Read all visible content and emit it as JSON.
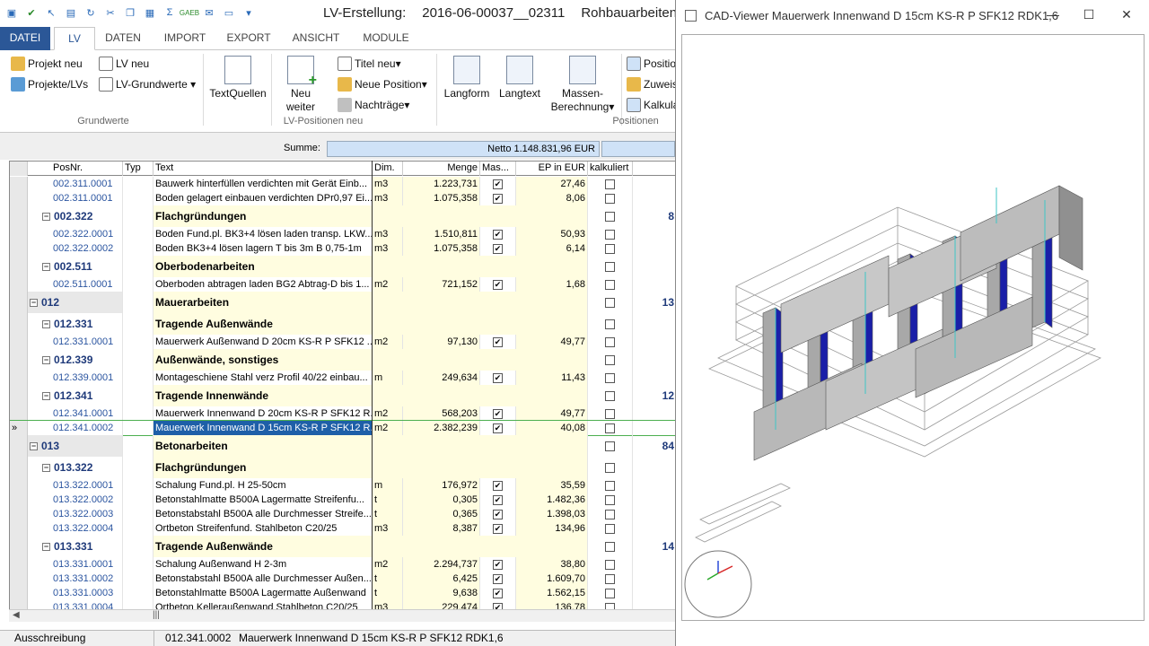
{
  "window": {
    "title_prefix": "LV-Erstellung:",
    "project_number": "2016-06-00037__02311",
    "project_name": "Rohbauarbeiten"
  },
  "tabs": [
    "DATEI",
    "LV",
    "DATEN",
    "IMPORT",
    "EXPORT",
    "ANSICHT",
    "MODULE"
  ],
  "ribbon": {
    "projekt_neu": "Projekt neu",
    "projekte_lvs": "Projekte/LVs",
    "lv_neu": "LV neu",
    "lv_grundwerte": "LV-Grundwerte",
    "textquellen": "TextQuellen",
    "neu_weiter_1": "Neu",
    "neu_weiter_2": "weiter",
    "titel_neu": "Titel neu",
    "neue_position": "Neue Position",
    "nachtraege": "Nachträge",
    "langform": "Langform",
    "langtext": "Langtext",
    "massen_1": "Massen-",
    "massen_2": "Berechnung",
    "position": "Positio",
    "zuweis": "Zuweis",
    "kalkula": "Kalkula",
    "group_grundwerte": "Grundwerte",
    "group_lv_positionen": "LV-Positionen neu",
    "group_positionen": "Positionen"
  },
  "summary": {
    "label": "Summe:",
    "netto": "Netto     1.148.831,96 EUR"
  },
  "columns": [
    "PosNr.",
    "Typ",
    "Text",
    "Dim.",
    "Menge",
    "Mas...",
    "EP in EUR",
    "kalkuliert"
  ],
  "rows": [
    {
      "kind": "item",
      "pos": "002.311.0001",
      "text": "Bauwerk hinterfüllen verdichten mit Gerät Einb...",
      "dim": "m3",
      "menge": "1.223,731",
      "mas": true,
      "ep": "27,46",
      "kalk": false,
      "extra": ""
    },
    {
      "kind": "item",
      "pos": "002.311.0001",
      "text": "Boden gelagert einbauen verdichten DPr0,97 Ei...",
      "dim": "m3",
      "menge": "1.075,358",
      "mas": true,
      "ep": "8,06",
      "kalk": false,
      "extra": ""
    },
    {
      "kind": "grp",
      "level": 2,
      "pos": "002.322",
      "text": "Flachgründungen",
      "kalk": false,
      "extra": "8"
    },
    {
      "kind": "item",
      "pos": "002.322.0001",
      "text": "Boden Fund.pl. BK3+4 lösen laden transp. LKW...",
      "dim": "m3",
      "menge": "1.510,811",
      "mas": true,
      "ep": "50,93",
      "kalk": false,
      "extra": ""
    },
    {
      "kind": "item",
      "pos": "002.322.0002",
      "text": "Boden BK3+4 lösen lagern T bis 3m B 0,75-1m",
      "dim": "m3",
      "menge": "1.075,358",
      "mas": true,
      "ep": "6,14",
      "kalk": false,
      "extra": ""
    },
    {
      "kind": "grp",
      "level": 2,
      "pos": "002.511",
      "text": "Oberbodenarbeiten",
      "kalk": false,
      "extra": ""
    },
    {
      "kind": "item",
      "pos": "002.511.0001",
      "text": "Oberboden abtragen laden BG2 Abtrag-D bis 1...",
      "dim": "m2",
      "menge": "721,152",
      "mas": true,
      "ep": "1,68",
      "kalk": false,
      "extra": ""
    },
    {
      "kind": "grp",
      "level": 1,
      "pos": "012",
      "text": "Mauerarbeiten",
      "kalk": false,
      "extra": "13"
    },
    {
      "kind": "grp",
      "level": 2,
      "pos": "012.331",
      "text": "Tragende Außenwände",
      "kalk": false,
      "extra": ""
    },
    {
      "kind": "item",
      "pos": "012.331.0001",
      "text": "Mauerwerk Außenwand D 20cm KS-R P SFK12 ...",
      "dim": "m2",
      "menge": "97,130",
      "mas": true,
      "ep": "49,77",
      "kalk": false,
      "extra": ""
    },
    {
      "kind": "grp",
      "level": 2,
      "pos": "012.339",
      "text": "Außenwände, sonstiges",
      "kalk": false,
      "extra": ""
    },
    {
      "kind": "item",
      "pos": "012.339.0001",
      "text": "Montageschiene Stahl verz Profil 40/22 einbau...",
      "dim": "m",
      "menge": "249,634",
      "mas": true,
      "ep": "11,43",
      "kalk": false,
      "extra": ""
    },
    {
      "kind": "grp",
      "level": 2,
      "pos": "012.341",
      "text": "Tragende Innenwände",
      "kalk": false,
      "extra": "12"
    },
    {
      "kind": "item",
      "pos": "012.341.0001",
      "text": "Mauerwerk Innenwand D 20cm KS-R P SFK12 R...",
      "dim": "m2",
      "menge": "568,203",
      "mas": true,
      "ep": "49,77",
      "kalk": false,
      "extra": ""
    },
    {
      "kind": "item",
      "sel": true,
      "pos": "012.341.0002",
      "text": "Mauerwerk Innenwand D 15cm KS-R P SFK12 R...",
      "dim": "m2",
      "menge": "2.382,239",
      "mas": true,
      "ep": "40,08",
      "kalk": false,
      "extra": ""
    },
    {
      "kind": "grp",
      "level": 1,
      "pos": "013",
      "text": "Betonarbeiten",
      "kalk": false,
      "extra": "84"
    },
    {
      "kind": "grp",
      "level": 2,
      "pos": "013.322",
      "text": "Flachgründungen",
      "kalk": false,
      "extra": ""
    },
    {
      "kind": "item",
      "pos": "013.322.0001",
      "text": "Schalung Fund.pl. H 25-50cm",
      "dim": "m",
      "menge": "176,972",
      "mas": true,
      "ep": "35,59",
      "kalk": false,
      "extra": ""
    },
    {
      "kind": "item",
      "pos": "013.322.0002",
      "text": "Betonstahlmatte B500A Lagermatte Streifenfu...",
      "dim": "t",
      "menge": "0,305",
      "mas": true,
      "ep": "1.482,36",
      "kalk": false,
      "extra": ""
    },
    {
      "kind": "item",
      "pos": "013.322.0003",
      "text": "Betonstabstahl B500A alle Durchmesser Streife...",
      "dim": "t",
      "menge": "0,365",
      "mas": true,
      "ep": "1.398,03",
      "kalk": false,
      "extra": ""
    },
    {
      "kind": "item",
      "pos": "013.322.0004",
      "text": "Ortbeton Streifenfund. Stahlbeton C20/25",
      "dim": "m3",
      "menge": "8,387",
      "mas": true,
      "ep": "134,96",
      "kalk": false,
      "extra": ""
    },
    {
      "kind": "grp",
      "level": 2,
      "pos": "013.331",
      "text": "Tragende Außenwände",
      "kalk": false,
      "extra": "14"
    },
    {
      "kind": "item",
      "pos": "013.331.0001",
      "text": "Schalung Außenwand H 2-3m",
      "dim": "m2",
      "menge": "2.294,737",
      "mas": true,
      "ep": "38,80",
      "kalk": false,
      "extra": ""
    },
    {
      "kind": "item",
      "pos": "013.331.0002",
      "text": "Betonstabstahl B500A alle Durchmesser Außen...",
      "dim": "t",
      "menge": "6,425",
      "mas": true,
      "ep": "1.609,70",
      "kalk": false,
      "extra": ""
    },
    {
      "kind": "item",
      "pos": "013.331.0003",
      "text": "Betonstahlmatte B500A Lagermatte Außenwand",
      "dim": "t",
      "menge": "9,638",
      "mas": true,
      "ep": "1.562,15",
      "kalk": false,
      "extra": ""
    },
    {
      "kind": "item",
      "pos": "013.331.0004",
      "text": "Ortbeton Kelleraußenwand Stahlbeton C20/25",
      "dim": "m3",
      "menge": "229,474",
      "mas": true,
      "ep": "136,78",
      "kalk": false,
      "extra": ""
    }
  ],
  "status": {
    "mode": "Ausschreibung",
    "pos": "012.341.0002",
    "text": "Mauerwerk Innenwand D 15cm KS-R P SFK12 RDK1,6"
  },
  "cad": {
    "title": "CAD-Viewer  Mauerwerk Innenwand D 15cm KS-R P SFK12 RDK1,6"
  }
}
